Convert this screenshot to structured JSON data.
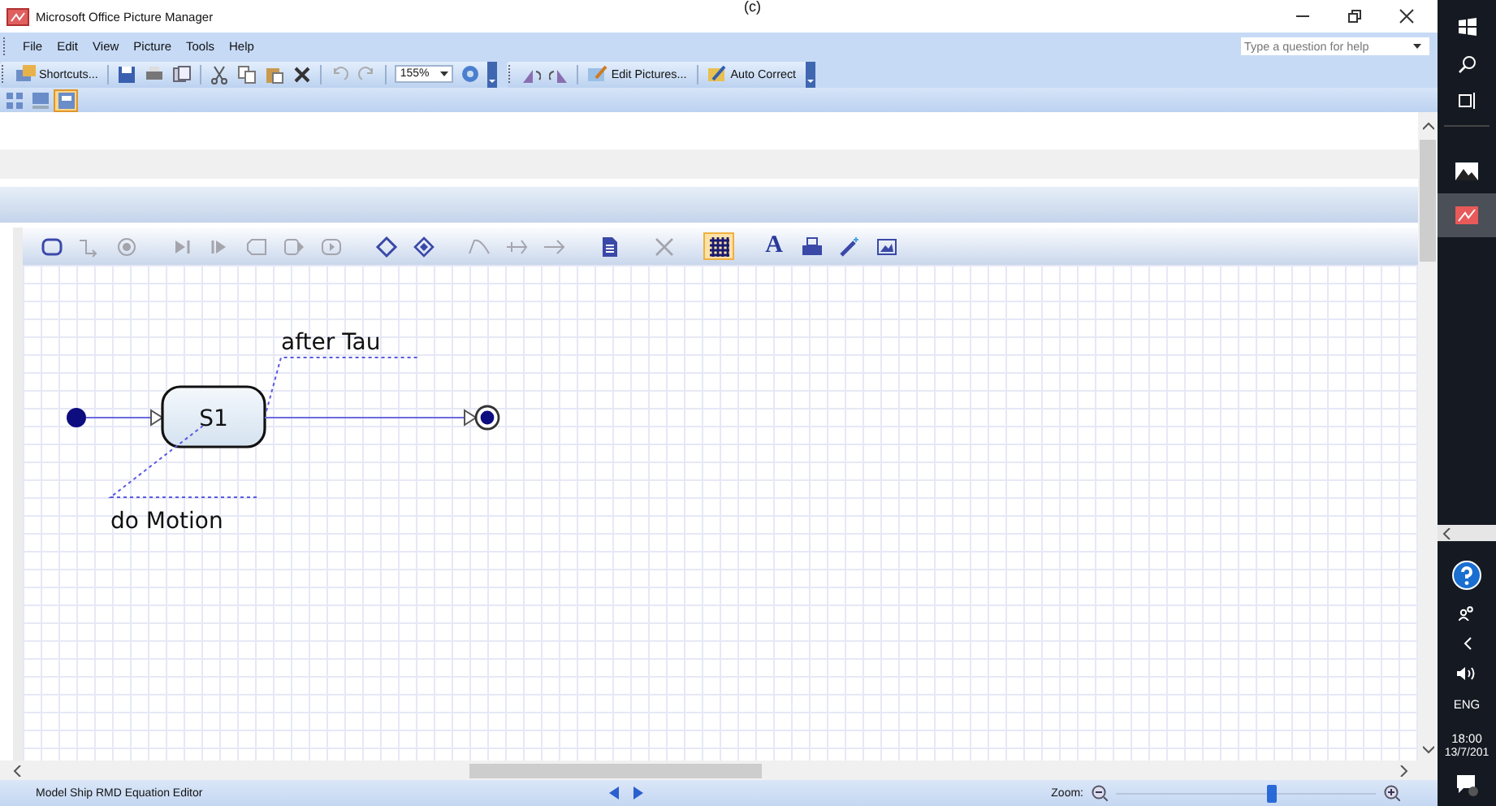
{
  "caption": "(c)",
  "window": {
    "title": "Microsoft Office Picture Manager"
  },
  "menu": [
    "File",
    "Edit",
    "View",
    "Picture",
    "Tools",
    "Help"
  ],
  "help_search": {
    "placeholder": "Type a question for help"
  },
  "toolbar": {
    "shortcuts": "Shortcuts...",
    "zoom": "155%",
    "edit_pictures": "Edit Pictures...",
    "auto_correct": "Auto Correct"
  },
  "view_buttons": [
    {
      "selected": false
    },
    {
      "selected": false
    },
    {
      "selected": true
    }
  ],
  "editor_tools": [
    {
      "disabled": false,
      "selected": false
    },
    {
      "disabled": true,
      "selected": false
    },
    {
      "disabled": true,
      "selected": false
    },
    {
      "disabled": true,
      "selected": false
    },
    {
      "disabled": true,
      "selected": false
    },
    {
      "disabled": true,
      "selected": false
    },
    {
      "disabled": true,
      "selected": false
    },
    {
      "disabled": true,
      "selected": false
    },
    {
      "disabled": false,
      "selected": false
    },
    {
      "disabled": false,
      "selected": false
    },
    {
      "disabled": true,
      "selected": false
    },
    {
      "disabled": true,
      "selected": false
    },
    {
      "disabled": true,
      "selected": false
    },
    {
      "disabled": false,
      "selected": false
    },
    {
      "disabled": true,
      "selected": false
    },
    {
      "disabled": false,
      "selected": true
    },
    {
      "label": "A",
      "disabled": false,
      "selected": false
    },
    {
      "disabled": false,
      "selected": false
    },
    {
      "disabled": false,
      "selected": false
    },
    {
      "disabled": false,
      "selected": false
    }
  ],
  "diagram": {
    "state": "S1",
    "transition_label": "after Tau",
    "activity_label": "do Motion"
  },
  "status_bar": {
    "text": "Model Ship RMD Equation Editor",
    "zoom_label": "Zoom:",
    "zoom": {
      "level": 0.6
    }
  },
  "taskbar": {
    "apps": [
      {
        "selected": false
      },
      {
        "selected": true
      }
    ],
    "language": "ENG",
    "time": "18:00",
    "date": "13/7/201"
  }
}
